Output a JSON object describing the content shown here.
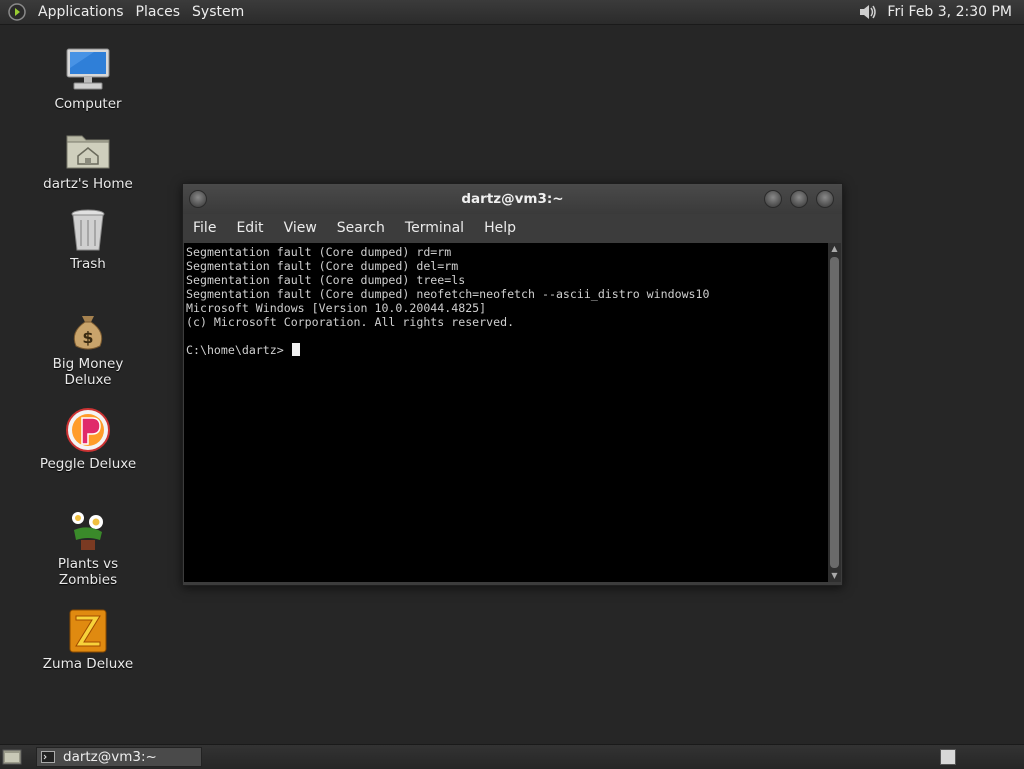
{
  "top_panel": {
    "menus": [
      "Applications",
      "Places",
      "System"
    ],
    "clock": "Fri Feb  3,  2:30 PM"
  },
  "desktop_icons": [
    {
      "label": "Computer",
      "icon": "computer-icon"
    },
    {
      "label": "dartz's Home",
      "icon": "home-folder-icon"
    },
    {
      "label": "Trash",
      "icon": "trash-icon"
    },
    {
      "label": "Big Money Deluxe",
      "icon": "money-bag-icon"
    },
    {
      "label": "Peggle Deluxe",
      "icon": "peggle-icon"
    },
    {
      "label": "Plants vs Zombies",
      "icon": "plants-vs-zombies-icon"
    },
    {
      "label": "Zuma Deluxe",
      "icon": "zuma-icon"
    }
  ],
  "terminal": {
    "title": "dartz@vm3:~",
    "menus": [
      "File",
      "Edit",
      "View",
      "Search",
      "Terminal",
      "Help"
    ],
    "lines": [
      "Segmentation fault (Core dumped) rd=rm",
      "Segmentation fault (Core dumped) del=rm",
      "Segmentation fault (Core dumped) tree=ls",
      "Segmentation fault (Core dumped) neofetch=neofetch --ascii_distro windows10",
      "Microsoft Windows [Version 10.0.20044.4825]",
      "(c) Microsoft Corporation. All rights reserved.",
      ""
    ],
    "prompt": "C:\\home\\dartz> "
  },
  "taskbar": {
    "task_label": "dartz@vm3:~"
  }
}
